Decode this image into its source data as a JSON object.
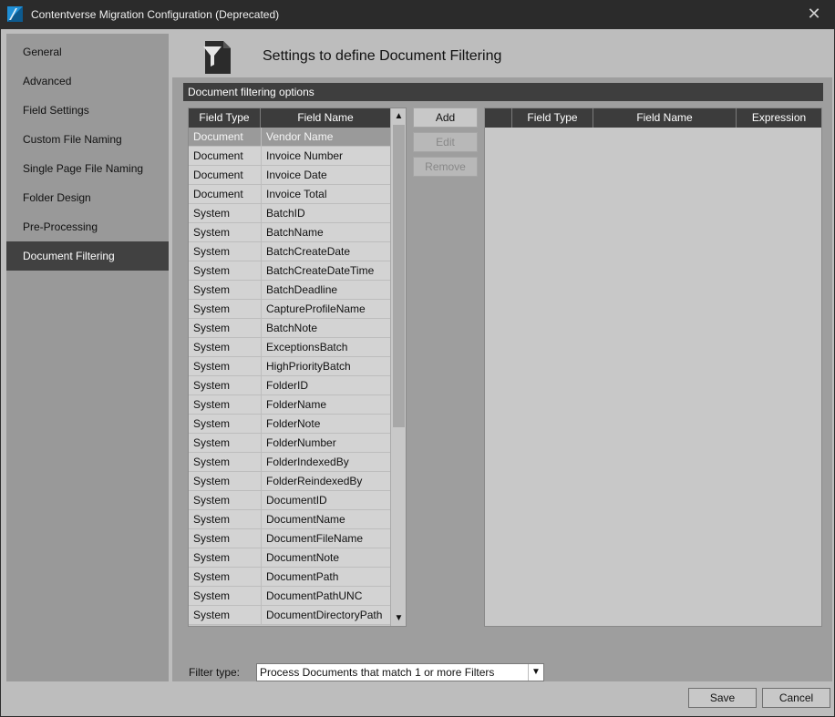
{
  "window": {
    "title": "Contentverse Migration Configuration (Deprecated)",
    "close_glyph": "✕",
    "app_icon": "contentverse-logo-icon"
  },
  "sidebar": {
    "items": [
      {
        "label": "General",
        "active": false
      },
      {
        "label": "Advanced",
        "active": false
      },
      {
        "label": "Field Settings",
        "active": false
      },
      {
        "label": "Custom File Naming",
        "active": false
      },
      {
        "label": "Single Page File Naming",
        "active": false
      },
      {
        "label": "Folder Design",
        "active": false
      },
      {
        "label": "Pre-Processing",
        "active": false
      },
      {
        "label": "Document Filtering",
        "active": true
      }
    ]
  },
  "header": {
    "title": "Settings to define Document Filtering",
    "icon": "filter-icon"
  },
  "section": {
    "title": "Document filtering options"
  },
  "fields_grid": {
    "columns": [
      "Field Type",
      "Field Name"
    ],
    "selected_index": 0,
    "rows": [
      [
        "Document",
        "Vendor Name"
      ],
      [
        "Document",
        "Invoice Number"
      ],
      [
        "Document",
        "Invoice Date"
      ],
      [
        "Document",
        "Invoice Total"
      ],
      [
        "System",
        "BatchID"
      ],
      [
        "System",
        "BatchName"
      ],
      [
        "System",
        "BatchCreateDate"
      ],
      [
        "System",
        "BatchCreateDateTime"
      ],
      [
        "System",
        "BatchDeadline"
      ],
      [
        "System",
        "CaptureProfileName"
      ],
      [
        "System",
        "BatchNote"
      ],
      [
        "System",
        "ExceptionsBatch"
      ],
      [
        "System",
        "HighPriorityBatch"
      ],
      [
        "System",
        "FolderID"
      ],
      [
        "System",
        "FolderName"
      ],
      [
        "System",
        "FolderNote"
      ],
      [
        "System",
        "FolderNumber"
      ],
      [
        "System",
        "FolderIndexedBy"
      ],
      [
        "System",
        "FolderReindexedBy"
      ],
      [
        "System",
        "DocumentID"
      ],
      [
        "System",
        "DocumentName"
      ],
      [
        "System",
        "DocumentFileName"
      ],
      [
        "System",
        "DocumentNote"
      ],
      [
        "System",
        "DocumentPath"
      ],
      [
        "System",
        "DocumentPathUNC"
      ],
      [
        "System",
        "DocumentDirectoryPath"
      ]
    ]
  },
  "buttons": {
    "add": "Add",
    "edit": "Edit",
    "remove": "Remove"
  },
  "filters_grid": {
    "columns": [
      "",
      "Field Type",
      "Field Name",
      "Expression"
    ],
    "rows": []
  },
  "filter_type": {
    "label": "Filter type:",
    "value": "Process Documents that match 1 or more Filters"
  },
  "footer": {
    "save": "Save",
    "cancel": "Cancel"
  }
}
